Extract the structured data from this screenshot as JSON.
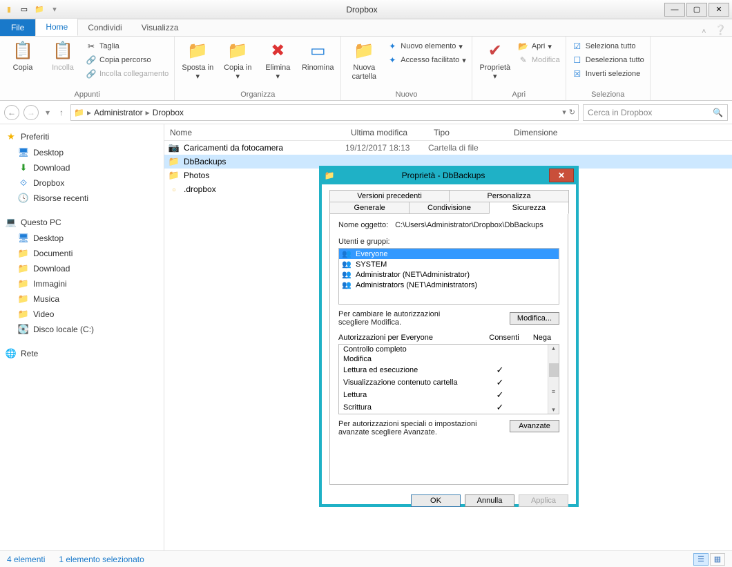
{
  "window": {
    "title": "Dropbox"
  },
  "tabs": {
    "file": "File",
    "home": "Home",
    "share": "Condividi",
    "view": "Visualizza"
  },
  "ribbon": {
    "groups": {
      "clipboard": "Appunti",
      "organise": "Organizza",
      "new": "Nuovo",
      "open": "Apri",
      "select": "Seleziona"
    },
    "copy": "Copia",
    "paste": "Incolla",
    "cut": "Taglia",
    "copypath": "Copia percorso",
    "pastelink": "Incolla collegamento",
    "move": "Sposta in",
    "copyto": "Copia in",
    "delete": "Elimina",
    "rename": "Rinomina",
    "newfolder": "Nuova cartella",
    "newitem": "Nuovo elemento",
    "easyaccess": "Accesso facilitato",
    "properties": "Proprietà",
    "openbtn": "Apri",
    "edit": "Modifica",
    "selectall": "Seleziona tutto",
    "deselect": "Deseleziona tutto",
    "invert": "Inverti selezione"
  },
  "breadcrumb": {
    "a": "Administrator",
    "b": "Dropbox"
  },
  "search": {
    "placeholder": "Cerca in Dropbox"
  },
  "columns": {
    "name": "Nome",
    "date": "Ultima modifica",
    "type": "Tipo",
    "size": "Dimensione"
  },
  "sidebar": {
    "favorites": "Preferiti",
    "fav": {
      "desktop": "Desktop",
      "download": "Download",
      "dropbox": "Dropbox",
      "recent": "Risorse recenti"
    },
    "thispc": "Questo PC",
    "pc": {
      "desktop": "Desktop",
      "documents": "Documenti",
      "download": "Download",
      "images": "Immagini",
      "music": "Musica",
      "video": "Video",
      "disk": "Disco locale (C:)"
    },
    "network": "Rete"
  },
  "files": [
    {
      "name": "Caricamenti da fotocamera",
      "date": "19/12/2017 18:13",
      "type": "Cartella di file",
      "icon": "📷"
    },
    {
      "name": "DbBackups",
      "date": "",
      "type": "",
      "icon": "📁",
      "selected": true
    },
    {
      "name": "Photos",
      "date": "",
      "type": "",
      "icon": "📁"
    },
    {
      "name": ".dropbox",
      "date": "",
      "type": "",
      "icon": "▫"
    }
  ],
  "status": {
    "count": "4 elementi",
    "selected": "1 elemento selezionato"
  },
  "dialog": {
    "title": "Proprietà - DbBackups",
    "tabs": {
      "general": "Generale",
      "sharing": "Condivisione",
      "security": "Sicurezza",
      "previous": "Versioni precedenti",
      "customise": "Personalizza"
    },
    "object_label": "Nome oggetto:",
    "object_path": "C:\\Users\\Administrator\\Dropbox\\DbBackups",
    "users_label": "Utenti e gruppi:",
    "users": [
      {
        "name": "Everyone",
        "selected": true
      },
      {
        "name": "SYSTEM"
      },
      {
        "name": "Administrator (NET\\Administrator)"
      },
      {
        "name": "Administrators (NET\\Administrators)"
      }
    ],
    "change_hint": "Per cambiare le autorizzazioni scegliere Modifica.",
    "modify_btn": "Modifica...",
    "perm_header": "Autorizzazioni per Everyone",
    "perm_allow": "Consenti",
    "perm_deny": "Nega",
    "perms": [
      {
        "name": "Controllo completo",
        "allow": false
      },
      {
        "name": "Modifica",
        "allow": false
      },
      {
        "name": "Lettura ed esecuzione",
        "allow": true
      },
      {
        "name": "Visualizzazione contenuto cartella",
        "allow": true
      },
      {
        "name": "Lettura",
        "allow": true
      },
      {
        "name": "Scrittura",
        "allow": true
      }
    ],
    "advanced_hint": "Per autorizzazioni speciali o impostazioni avanzate scegliere Avanzate.",
    "advanced_btn": "Avanzate",
    "ok": "OK",
    "cancel": "Annulla",
    "apply": "Applica"
  }
}
